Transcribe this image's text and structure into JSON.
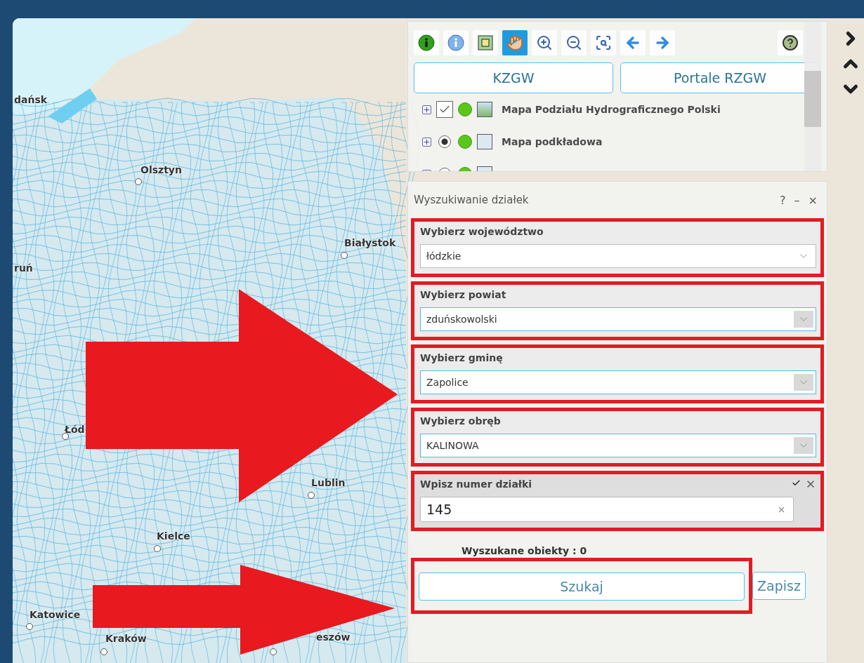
{
  "map": {
    "labels": [
      {
        "text": "dańsk",
        "dot": false
      },
      {
        "text": "Olsztyn",
        "dot": true
      },
      {
        "text": "Białystok",
        "dot": true
      },
      {
        "text": "ruń",
        "dot": false
      },
      {
        "text": "Łód",
        "dot": true
      },
      {
        "text": "Lublin",
        "dot": true
      },
      {
        "text": "Kielce",
        "dot": true
      },
      {
        "text": "Katowice",
        "dot": true
      },
      {
        "text": "Kraków",
        "dot": true
      },
      {
        "text": "eszów",
        "dot": true
      }
    ]
  },
  "toolbar": {
    "tools": [
      {
        "kind": "identify",
        "selected": false
      },
      {
        "kind": "info",
        "selected": false
      },
      {
        "kind": "extent",
        "selected": false
      },
      {
        "kind": "pan",
        "selected": true
      },
      {
        "kind": "zoom-in",
        "selected": false
      },
      {
        "kind": "zoom-out",
        "selected": false
      },
      {
        "kind": "zoom-full",
        "selected": false
      },
      {
        "kind": "back",
        "selected": false
      },
      {
        "kind": "forward",
        "selected": false
      }
    ],
    "help": {
      "kind": "help"
    }
  },
  "portal_buttons": [
    "KZGW",
    "Portale RZGW"
  ],
  "layers": [
    {
      "kind": "checkbox",
      "checked": true,
      "label": "Mapa Podziału Hydrograficznego Polski"
    },
    {
      "kind": "radio",
      "checked": true,
      "label": "Mapa podkładowa"
    },
    {
      "kind": "radio",
      "checked": false
    }
  ],
  "search": {
    "title": "Wyszukiwanie działek",
    "header_controls": [
      "?",
      "–",
      "×"
    ],
    "fields": [
      {
        "kind": "select",
        "label": "Wybierz województwo",
        "value": "łódzkie",
        "active": false,
        "annotated": true
      },
      {
        "kind": "select",
        "label": "Wybierz powiat",
        "value": "zduńskowolski",
        "active": true,
        "annotated": true
      },
      {
        "kind": "select",
        "label": "Wybierz gminę",
        "value": "Zapolice",
        "active": true,
        "annotated": true
      },
      {
        "kind": "select",
        "label": "Wybierz obręb",
        "value": "KALINOWA",
        "active": true,
        "annotated": true
      },
      {
        "kind": "text",
        "label": "Wpisz numer działki",
        "value": "145",
        "active": false,
        "annotated": true
      }
    ],
    "result": "Wyszukane obiekty : 0",
    "buttons": [
      {
        "label": "Szukaj",
        "annotated": true
      },
      {
        "label": "Zapisz",
        "annotated": false
      }
    ]
  }
}
